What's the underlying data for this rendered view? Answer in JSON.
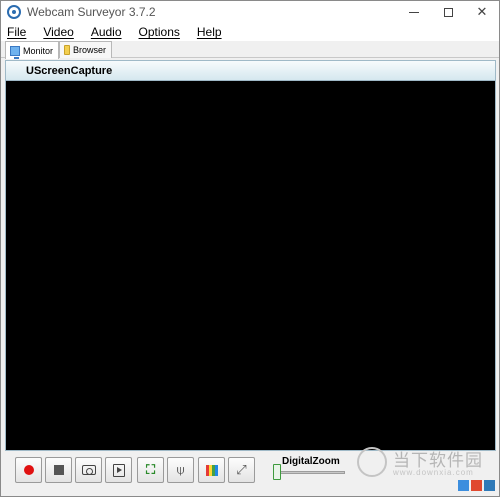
{
  "window": {
    "title": "Webcam Surveyor 3.7.2",
    "controls": {
      "minimize": "—",
      "maximize": "□",
      "close": "✕"
    }
  },
  "menu": [
    "File",
    "Video",
    "Audio",
    "Options",
    "Help"
  ],
  "tabs": [
    {
      "label": "Monitor",
      "icon": "monitor-icon",
      "active": true
    },
    {
      "label": "Browser",
      "icon": "folder-icon",
      "active": false
    }
  ],
  "capture": {
    "source_label": "UScreenCapture"
  },
  "toolbar": {
    "buttons": [
      {
        "name": "record",
        "icon": "record-icon",
        "color": "#e01010"
      },
      {
        "name": "stop",
        "icon": "stop-icon"
      },
      {
        "name": "snapshot",
        "icon": "camera-icon"
      },
      {
        "name": "video",
        "icon": "film-play-icon"
      },
      {
        "name": "motion-detection",
        "icon": "motion-icon",
        "glyph": "⛶"
      },
      {
        "name": "broadcast",
        "icon": "antenna-icon",
        "glyph": "⍦"
      },
      {
        "name": "color-settings",
        "icon": "color-bars-icon"
      },
      {
        "name": "fullscreen",
        "icon": "expand-icon",
        "glyph": "⤢"
      }
    ],
    "zoom": {
      "label": "DigitalZoom",
      "value": 0
    }
  },
  "watermark": {
    "title": "当下软件园",
    "subtitle": "www.downxia.com"
  }
}
